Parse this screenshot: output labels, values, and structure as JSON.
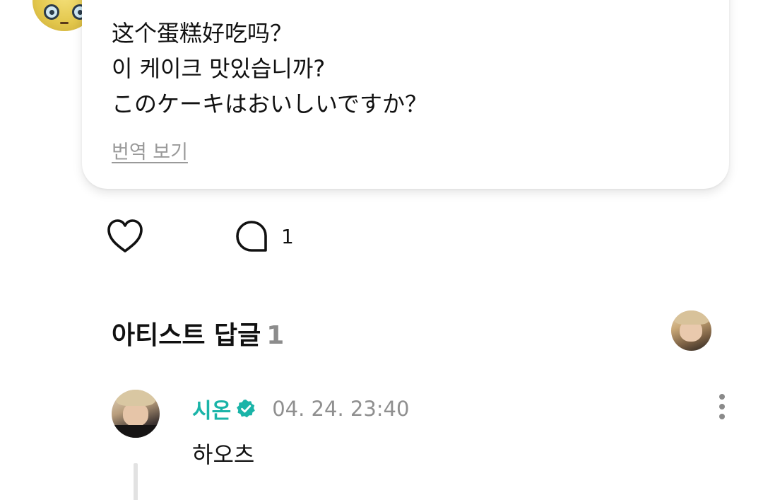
{
  "post": {
    "lines": [
      "这个蛋糕好吃吗？",
      "이 케이크 맛있습니까?",
      "このケーキはおいしいですか？"
    ],
    "translate_label": "번역 보기",
    "avatar_icon": "character-avatar"
  },
  "actions": {
    "like_icon": "heart-icon",
    "comment_icon": "comment-bubble-icon",
    "comment_count": "1"
  },
  "artist_reply": {
    "title": "아티스트 답글",
    "count": "1"
  },
  "comment": {
    "author": "시온",
    "verified_icon": "verified-badge-icon",
    "timestamp": "04. 24. 23:40",
    "text": "하오츠",
    "accent_color": "#1ab4a8",
    "more_icon": "more-vertical-icon"
  }
}
